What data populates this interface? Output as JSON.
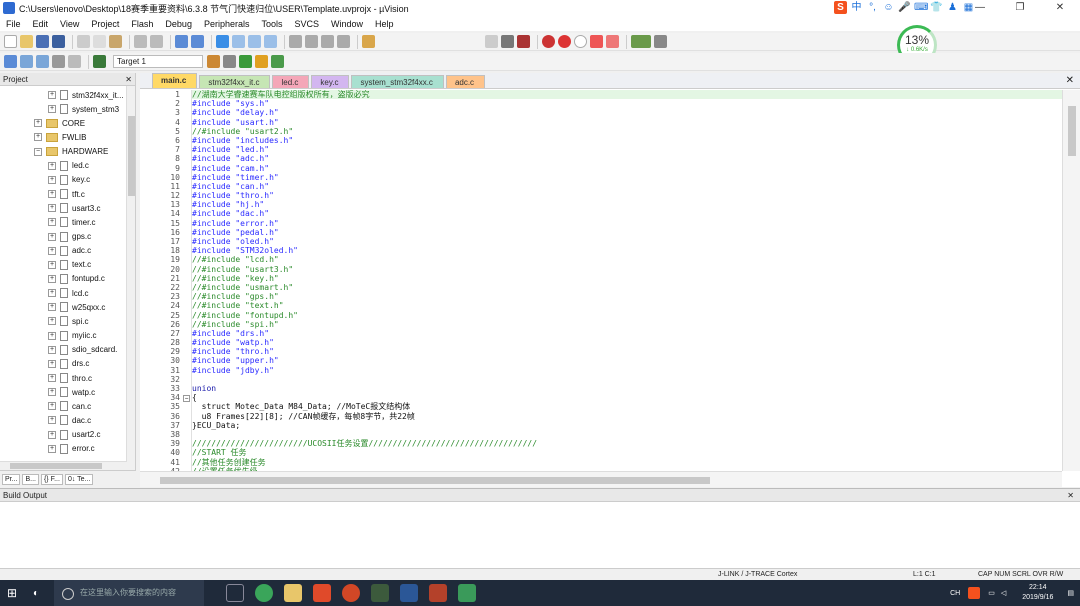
{
  "window": {
    "title": "C:\\Users\\lenovo\\Desktop\\18赛季重要资料\\6.3.8 节气门快速归位\\USER\\Template.uvprojx - µVision",
    "controls": [
      "—",
      "❐",
      "✕"
    ]
  },
  "menu": [
    "File",
    "Edit",
    "View",
    "Project",
    "Flash",
    "Debug",
    "Peripherals",
    "Tools",
    "SVCS",
    "Window",
    "Help"
  ],
  "ime": [
    "S",
    "中",
    "°,",
    "☺",
    "🎤",
    "⌨",
    "👕",
    "♟",
    "▦"
  ],
  "toolbar": {
    "target": "Target 1"
  },
  "cpu": {
    "percent": "13%",
    "rate": "↓ 0.6K/s"
  },
  "project": {
    "title": "Project",
    "close": "✕",
    "items": [
      {
        "label": "stm32f4xx_it...",
        "indent": 2,
        "kind": "file"
      },
      {
        "label": "system_stm3",
        "indent": 2,
        "kind": "file"
      },
      {
        "label": "CORE",
        "indent": 1,
        "kind": "folder"
      },
      {
        "label": "FWLIB",
        "indent": 1,
        "kind": "folder"
      },
      {
        "label": "HARDWARE",
        "indent": 1,
        "kind": "folder-open"
      },
      {
        "label": "led.c",
        "indent": 2,
        "kind": "file"
      },
      {
        "label": "key.c",
        "indent": 2,
        "kind": "file"
      },
      {
        "label": "tft.c",
        "indent": 2,
        "kind": "file"
      },
      {
        "label": "usart3.c",
        "indent": 2,
        "kind": "file"
      },
      {
        "label": "timer.c",
        "indent": 2,
        "kind": "file"
      },
      {
        "label": "gps.c",
        "indent": 2,
        "kind": "file"
      },
      {
        "label": "adc.c",
        "indent": 2,
        "kind": "file"
      },
      {
        "label": "text.c",
        "indent": 2,
        "kind": "file"
      },
      {
        "label": "fontupd.c",
        "indent": 2,
        "kind": "file"
      },
      {
        "label": "lcd.c",
        "indent": 2,
        "kind": "file"
      },
      {
        "label": "w25qxx.c",
        "indent": 2,
        "kind": "file"
      },
      {
        "label": "spi.c",
        "indent": 2,
        "kind": "file"
      },
      {
        "label": "myiic.c",
        "indent": 2,
        "kind": "file"
      },
      {
        "label": "sdio_sdcard.",
        "indent": 2,
        "kind": "file"
      },
      {
        "label": "drs.c",
        "indent": 2,
        "kind": "file"
      },
      {
        "label": "thro.c",
        "indent": 2,
        "kind": "file"
      },
      {
        "label": "watp.c",
        "indent": 2,
        "kind": "file"
      },
      {
        "label": "can.c",
        "indent": 2,
        "kind": "file"
      },
      {
        "label": "dac.c",
        "indent": 2,
        "kind": "file"
      },
      {
        "label": "usart2.c",
        "indent": 2,
        "kind": "file"
      },
      {
        "label": "error.c",
        "indent": 2,
        "kind": "file"
      }
    ],
    "tabs": [
      "Pr...",
      "B...",
      "{} F...",
      "0↓ Te..."
    ]
  },
  "tabs": [
    {
      "label": "main.c",
      "color": "#ffd966",
      "active": true
    },
    {
      "label": "stm32f4xx_it.c",
      "color": "#c6e6b4"
    },
    {
      "label": "led.c",
      "color": "#f4a6b8"
    },
    {
      "label": "key.c",
      "color": "#d3b6f0"
    },
    {
      "label": "system_stm32f4xx.c",
      "color": "#a8e0d0"
    },
    {
      "label": "adc.c",
      "color": "#ffc38a"
    }
  ],
  "code": [
    {
      "n": "1",
      "t": "//湖南大学睿速赛车队电控组版权所有，盗版必究",
      "c": "c-green",
      "hl": true
    },
    {
      "n": "2",
      "t": "#include \"sys.h\"",
      "c": "c-blue"
    },
    {
      "n": "3",
      "t": "#include \"delay.h\"",
      "c": "c-blue"
    },
    {
      "n": "4",
      "t": "#include \"usart.h\"",
      "c": "c-blue"
    },
    {
      "n": "5",
      "t": "//#include \"usart2.h\"",
      "c": "c-green"
    },
    {
      "n": "6",
      "t": "#include \"includes.h\"",
      "c": "c-blue"
    },
    {
      "n": "7",
      "t": "#include \"led.h\"",
      "c": "c-blue"
    },
    {
      "n": "8",
      "t": "#include \"adc.h\"",
      "c": "c-blue"
    },
    {
      "n": "9",
      "t": "#include \"cam.h\"",
      "c": "c-blue"
    },
    {
      "n": "10",
      "t": "#include \"timer.h\"",
      "c": "c-blue"
    },
    {
      "n": "11",
      "t": "#include \"can.h\"",
      "c": "c-blue"
    },
    {
      "n": "12",
      "t": "#include \"thro.h\"",
      "c": "c-blue"
    },
    {
      "n": "13",
      "t": "#include \"hj.h\"",
      "c": "c-blue"
    },
    {
      "n": "14",
      "t": "#include \"dac.h\"",
      "c": "c-blue"
    },
    {
      "n": "15",
      "t": "#include \"error.h\"",
      "c": "c-blue"
    },
    {
      "n": "16",
      "t": "#include \"pedal.h\"",
      "c": "c-blue"
    },
    {
      "n": "17",
      "t": "#include \"oled.h\"",
      "c": "c-blue"
    },
    {
      "n": "18",
      "t": "#include \"STM32oled.h\"",
      "c": "c-blue"
    },
    {
      "n": "19",
      "t": "//#include \"lcd.h\"",
      "c": "c-green"
    },
    {
      "n": "20",
      "t": "//#include \"usart3.h\"",
      "c": "c-green"
    },
    {
      "n": "21",
      "t": "//#include \"key.h\"",
      "c": "c-green"
    },
    {
      "n": "22",
      "t": "//#include \"usmart.h\"",
      "c": "c-green"
    },
    {
      "n": "23",
      "t": "//#include \"gps.h\"",
      "c": "c-green"
    },
    {
      "n": "24",
      "t": "//#include \"text.h\"",
      "c": "c-green"
    },
    {
      "n": "25",
      "t": "//#include \"fontupd.h\"",
      "c": "c-green"
    },
    {
      "n": "26",
      "t": "//#include \"spi.h\"",
      "c": "c-green"
    },
    {
      "n": "27",
      "t": "#include \"drs.h\"",
      "c": "c-blue"
    },
    {
      "n": "28",
      "t": "#include \"watp.h\"",
      "c": "c-blue"
    },
    {
      "n": "29",
      "t": "#include \"thro.h\"",
      "c": "c-blue"
    },
    {
      "n": "30",
      "t": "#include \"upper.h\"",
      "c": "c-blue"
    },
    {
      "n": "31",
      "t": "#include \"jdby.h\"",
      "c": "c-blue"
    },
    {
      "n": "32",
      "t": "",
      "c": "c-def"
    },
    {
      "n": "33",
      "t": "union",
      "c": "c-kw"
    },
    {
      "n": "34",
      "t": "{",
      "c": "c-def",
      "fold": true
    },
    {
      "n": "35",
      "t": "  struct Motec_Data M84_Data; //MoTeC报文结构体",
      "c": "c-def"
    },
    {
      "n": "36",
      "t": "  u8 Frames[22][8]; //CAN帧缓存，每帧8字节，共22帧",
      "c": "c-def"
    },
    {
      "n": "37",
      "t": "}ECU_Data;",
      "c": "c-def"
    },
    {
      "n": "38",
      "t": "",
      "c": "c-def"
    },
    {
      "n": "39",
      "t": "////////////////////////UCOSII任务设置///////////////////////////////////",
      "c": "c-green"
    },
    {
      "n": "40",
      "t": "//START 任务",
      "c": "c-green"
    },
    {
      "n": "41",
      "t": "//其他任务创建任务",
      "c": "c-green"
    },
    {
      "n": "42",
      "t": "//设置任务优先级",
      "c": "c-green"
    }
  ],
  "build": {
    "title": "Build Output",
    "close": "✕"
  },
  "status": {
    "debugger": "J-LINK / J-TRACE Cortex",
    "pos": "L:1 C:1",
    "flags": "CAP  NUM  SCRL  OVR  R/W"
  },
  "taskbar": {
    "search": "在这里输入你要搜索的内容",
    "time": "22:14",
    "date": "2019/9/16",
    "lang": "CH"
  }
}
